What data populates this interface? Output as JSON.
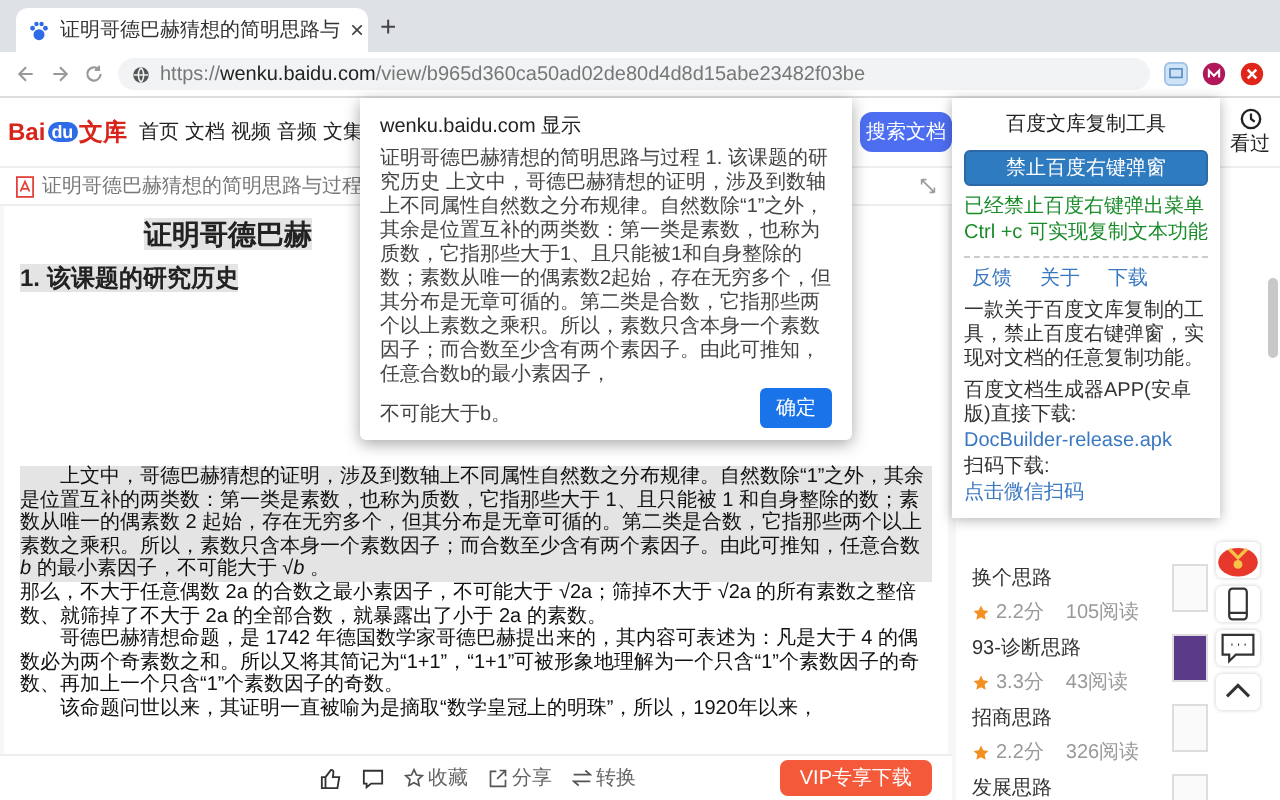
{
  "browser": {
    "tab": {
      "title": "证明哥德巴赫猜想的简明思路与",
      "close": "×"
    },
    "new_tab": "+",
    "url": {
      "scheme": "https://",
      "domain": "wenku.baidu.com",
      "path": "/view/b965d360ca50ad02de80d4d8d15abe23482f03be"
    }
  },
  "site_header": {
    "logo": {
      "prefix": "Bai",
      "badge": "du",
      "suffix": "文库"
    },
    "nav": [
      "首页",
      "文档",
      "视频",
      "音频",
      "文集"
    ],
    "search_button": "搜索文档",
    "history": "看过"
  },
  "document": {
    "breadcrumb": "证明哥德巴赫猜想的简明思路与过程",
    "title": "证明哥德巴赫",
    "heading": "1. 该课题的研究历史",
    "paragraphs": [
      {
        "text": "上文中，哥德巴赫猜想的证明，涉及到数轴上不同属性自然数之分布规律。自然数除“1”之外，其余是位置互补的两类数：第一类是素数，也称为质数，它指那些大于 1、且只能被 1 和自身整除的数；素数从唯一的偶素数 2 起始，存在无穷多个，但其分布是无章可循的。第二类是合数，它指那些两个以上素数之乘积。所以，素数只含本身一个素数因子；而合数至少含有两个素因子。由此可推知，任意合数 *b* 的最小素因子，不可能大于 √*b* 。",
        "highlighted": true,
        "indent": true
      },
      {
        "text": "那么，不大于任意偶数 2a 的合数之最小素因子，不可能大于 √2a；筛掉不大于 √2a 的所有素数之整倍数、就筛掉了不大于 2a 的全部合数，就暴露出了小于 2a 的素数。",
        "highlighted": false,
        "indent": false
      },
      {
        "text": "哥德巴赫猜想命题，是 1742 年德国数学家哥德巴赫提出来的，其内容可表述为：凡是大于 4 的偶数必为两个奇素数之和。所以又将其简记为“1+1”，“1+1”可被形象地理解为一个只含“1”个素数因子的奇数、再加上一个只含“1”个素数因子的奇数。",
        "highlighted": false,
        "indent": true
      },
      {
        "text": "该命题问世以来，其证明一直被喻为是摘取“数学皇冠上的明珠”，所以，1920年以来，",
        "highlighted": false,
        "indent": true
      }
    ],
    "toolbar": {
      "actions": [
        {
          "kind": "star",
          "label": "收藏"
        },
        {
          "kind": "share",
          "label": "分享"
        },
        {
          "kind": "convert",
          "label": "转换"
        }
      ],
      "download_button": "VIP专享下载"
    }
  },
  "related": [
    {
      "title": "换个思路",
      "rating": "2.2分",
      "reads": "105阅读",
      "kind": "page"
    },
    {
      "title": "93-诊断思路",
      "rating": "3.3分",
      "reads": "43阅读",
      "kind": "photo"
    },
    {
      "title": "招商思路",
      "rating": "2.2分",
      "reads": "326阅读",
      "kind": "page"
    },
    {
      "title": "发展思路",
      "kind": "page"
    }
  ],
  "dialog": {
    "title": "wenku.baidu.com 显示",
    "message": [
      "证明哥德巴赫猜想的简明思路与过程 1. 该课题的研究历史 上文中，哥德巴赫猜想的证明，涉及到数轴上不同属性自然数之分布规律。自然数除“1”之外，其余是位置互补的两类数：第一类是素数，也称为质数，它指那些大于1、且只能被1和自身整除的数；素数从唯一的偶素数2起始，存在无穷多个，但其分布是无章可循的。第二类是合数，它指那些两个以上素数之乘积。所以，素数只含本身一个素数因子；而合数至少含有两个素因子。由此可推知，任意合数b的最小素因子，",
      "不可能大于b。"
    ],
    "ok_button": "确定"
  },
  "extension_popup": {
    "title": "百度文库复制工具",
    "button": "禁止百度右键弹窗",
    "status": [
      "已经禁止百度右键弹出菜单",
      "Ctrl +c 可实现复制文本功能"
    ],
    "links": [
      "反馈",
      "关于",
      "下载"
    ],
    "description": "一款关于百度文库复制的工具，禁止百度右键弹窗，实现对文档的任意复制功能。",
    "app_text": "百度文档生成器APP(安卓版)直接下载:",
    "app_link": "DocBuilder-release.apk",
    "scan_text": "扫码下载:",
    "scan_link": "点击微信扫码"
  }
}
